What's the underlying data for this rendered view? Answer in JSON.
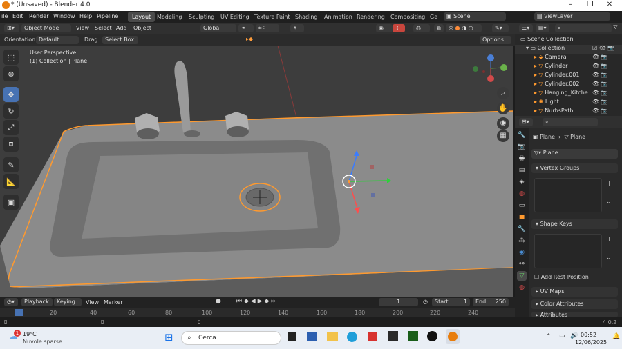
{
  "window": {
    "title": "* (Unsaved) - Blender 4.0"
  },
  "menus": [
    "ile",
    "Edit",
    "Render",
    "Window",
    "Help",
    "Pipeline"
  ],
  "workspaces": [
    "Layout",
    "Modeling",
    "Sculpting",
    "UV Editing",
    "Texture Paint",
    "Shading",
    "Animation",
    "Rendering",
    "Compositing",
    "Ge"
  ],
  "scene": {
    "label": "Scene",
    "view_layer": "ViewLayer"
  },
  "header3d": {
    "mode": "Object Mode",
    "view": "View",
    "select": "Select",
    "add": "Add",
    "object": "Object",
    "orientation_global": "Global"
  },
  "header3d2": {
    "orientation_label": "Orientation:",
    "orientation_value": "Default",
    "drag_label": "Drag:",
    "drag_value": "Select Box",
    "options": "Options"
  },
  "viewport": {
    "perspective": "User Perspective",
    "collection": "(1) Collection | Plane"
  },
  "outliner": {
    "root": "Scene Collection",
    "collection": "Collection",
    "items": [
      "Camera",
      "Cylinder",
      "Cylinder.001",
      "Cylinder.002",
      "Hanging_Kitche",
      "Light",
      "NurbsPath"
    ]
  },
  "properties": {
    "breadcrumb": [
      "Plane",
      "Plane"
    ],
    "mesh_name": "Plane",
    "sections": [
      "Vertex Groups",
      "Shape Keys",
      "UV Maps",
      "Color Attributes",
      "Attributes"
    ],
    "add_rest_position": "Add Rest Position"
  },
  "timeline": {
    "playback": "Playback",
    "keying": "Keying",
    "view": "View",
    "marker": "Marker",
    "frame": "1",
    "start_label": "Start",
    "start": "1",
    "end_label": "End",
    "end": "250",
    "ruler": [
      "20",
      "40",
      "60",
      "80",
      "100",
      "120",
      "140",
      "160",
      "180",
      "200",
      "220",
      "240"
    ]
  },
  "status": {
    "version": "4.0.2"
  },
  "taskbar": {
    "temp": "19°C",
    "weather": "Nuvole sparse",
    "search": "Cerca",
    "time": "00:52",
    "date": "12/06/2025",
    "badge": "1"
  }
}
